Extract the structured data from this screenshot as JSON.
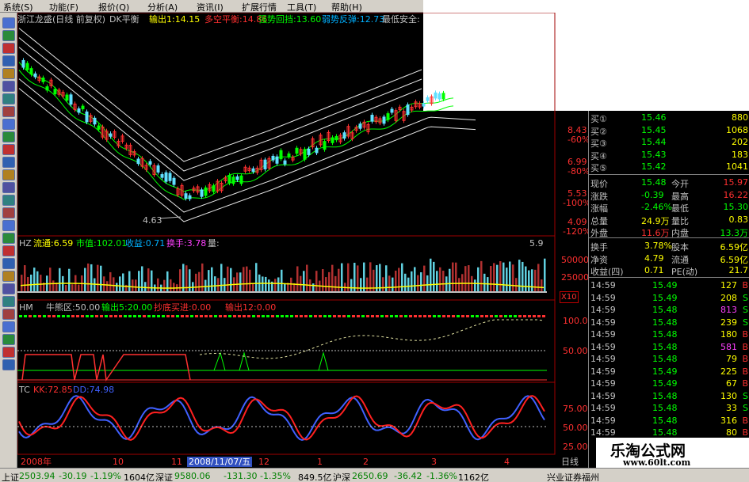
{
  "menu": [
    "系统(S)",
    "功能(F)",
    "报价(Q)",
    "分析(A)",
    "资讯(I)",
    "扩展行情",
    "工具(T)",
    "帮助(H)"
  ],
  "main_header": {
    "title": "浙江龙盛(日线 前复权)",
    "indicator": "DK平衡",
    "items": [
      {
        "text": "输出1:14.15",
        "color": "#ffff00"
      },
      {
        "text": "多空平衡:14.86",
        "color": "#ff3030"
      },
      {
        "text": "强势回挡:13.60",
        "color": "#00ff00"
      },
      {
        "text": "弱势反弹:12.73",
        "color": "#00b0ff"
      },
      {
        "text": "最低安全:",
        "color": "#c0c0c0"
      }
    ],
    "low_marker": "4.63"
  },
  "price_axis": [
    {
      "price": "8.43",
      "pct": "-60%"
    },
    {
      "price": "6.99",
      "pct": "-80%"
    },
    {
      "price": "5.53",
      "pct": "-100%"
    },
    {
      "price": "4.09",
      "pct": "-120%"
    }
  ],
  "hz_header": {
    "label": "HZ",
    "items": [
      {
        "text": "流通:6.59",
        "color": "#ffff00"
      },
      {
        "text": "市值:102.01",
        "color": "#00ff00"
      },
      {
        "text": "收益:0.71",
        "color": "#00b0ff"
      },
      {
        "text": "换手:3.78",
        "color": "#ff40ff"
      },
      {
        "text": "量:",
        "color": "#c0c0c0"
      }
    ],
    "right_value": "5.9"
  },
  "volume_axis": [
    "50000",
    "25000"
  ],
  "volume_unit": "X10",
  "hm_header": {
    "label": "HM",
    "items": [
      {
        "text": "牛熊区:50.00",
        "color": "#c0c0c0"
      },
      {
        "text": "输出5:20.00",
        "color": "#00ff00"
      },
      {
        "text": "抄底买进:0.00",
        "color": "#ff3030"
      },
      {
        "text": "输出12:0.00",
        "color": "#ff3030"
      }
    ]
  },
  "hm_axis": [
    "100.0",
    "50.00"
  ],
  "tc_header": {
    "label": "TC",
    "items": [
      {
        "text": "KK:72.85",
        "color": "#ff3030"
      },
      {
        "text": "DD:74.98",
        "color": "#4060ff"
      }
    ]
  },
  "tc_axis": [
    "75.00",
    "50.00",
    "25.00"
  ],
  "time_axis": {
    "labels": [
      "2008年",
      "10",
      "11",
      "12",
      "1",
      "2",
      "3",
      "4"
    ],
    "cursor_date": "2008/11/07/五",
    "period": "日线"
  },
  "quote": {
    "bids": [
      {
        "label": "买①",
        "price": "15.46",
        "vol": "880"
      },
      {
        "label": "买②",
        "price": "15.45",
        "vol": "1068"
      },
      {
        "label": "买③",
        "price": "15.44",
        "vol": "202"
      },
      {
        "label": "买④",
        "price": "15.43",
        "vol": "183"
      },
      {
        "label": "买⑤",
        "price": "15.42",
        "vol": "1041"
      }
    ],
    "stats": [
      {
        "l1": "现价",
        "v1": "15.48",
        "l2": "今开",
        "v2": "15.97",
        "c1": "#00ff00",
        "c2": "#ff3030"
      },
      {
        "l1": "涨跌",
        "v1": "-0.39",
        "l2": "最高",
        "v2": "16.22",
        "c1": "#00ff00",
        "c2": "#ff3030"
      },
      {
        "l1": "涨幅",
        "v1": "-2.46%",
        "l2": "最低",
        "v2": "15.30",
        "c1": "#00ff00",
        "c2": "#00ff00"
      },
      {
        "l1": "总量",
        "v1": "24.9万",
        "l2": "量比",
        "v2": "0.83",
        "c1": "#ffff00",
        "c2": "#ffff00"
      },
      {
        "l1": "外盘",
        "v1": "11.6万",
        "l2": "内盘",
        "v2": "13.3万",
        "c1": "#ff3030",
        "c2": "#00ff00"
      }
    ],
    "stats2": [
      {
        "l1": "换手",
        "v1": "3.78%",
        "l2": "股本",
        "v2": "6.59亿"
      },
      {
        "l1": "净资",
        "v1": "4.79",
        "l2": "流通",
        "v2": "6.59亿"
      },
      {
        "l1": "收益(四)",
        "v1": "0.71",
        "l2": "PE(动)",
        "v2": "21.7"
      }
    ],
    "ticks": [
      {
        "time": "14:59",
        "price": "15.49",
        "vol": "127",
        "bs": "B"
      },
      {
        "time": "14:59",
        "price": "15.49",
        "vol": "208",
        "bs": "S"
      },
      {
        "time": "14:59",
        "price": "15.48",
        "vol": "813",
        "bs": "S"
      },
      {
        "time": "14:59",
        "price": "15.48",
        "vol": "239",
        "bs": "S"
      },
      {
        "time": "14:59",
        "price": "15.48",
        "vol": "180",
        "bs": "B"
      },
      {
        "time": "14:59",
        "price": "15.48",
        "vol": "581",
        "bs": "B"
      },
      {
        "time": "14:59",
        "price": "15.48",
        "vol": "79",
        "bs": "B"
      },
      {
        "time": "14:59",
        "price": "15.49",
        "vol": "225",
        "bs": "B"
      },
      {
        "time": "14:59",
        "price": "15.49",
        "vol": "67",
        "bs": "B"
      },
      {
        "time": "14:59",
        "price": "15.48",
        "vol": "130",
        "bs": "S"
      },
      {
        "time": "14:59",
        "price": "15.48",
        "vol": "33",
        "bs": "S"
      },
      {
        "time": "14:59",
        "price": "15.48",
        "vol": "316",
        "bs": "B"
      },
      {
        "time": "14:59",
        "price": "15.48",
        "vol": "80",
        "bs": "B"
      }
    ]
  },
  "status_bar": [
    {
      "text": "上证",
      "color": "#000000"
    },
    {
      "text": "2503.94",
      "color": "#008000"
    },
    {
      "text": "-30.19",
      "color": "#008000"
    },
    {
      "text": "-1.19%",
      "color": "#008000"
    },
    {
      "text": "1604亿",
      "color": "#000000"
    },
    {
      "text": "深证",
      "color": "#000000"
    },
    {
      "text": "9580.06",
      "color": "#008000"
    },
    {
      "text": "-131.30",
      "color": "#008000"
    },
    {
      "text": "-1.35%",
      "color": "#008000"
    },
    {
      "text": "849.5亿",
      "color": "#000000"
    },
    {
      "text": "沪深",
      "color": "#000000"
    },
    {
      "text": "2650.69",
      "color": "#008000"
    },
    {
      "text": "-36.42",
      "color": "#008000"
    },
    {
      "text": "-1.36%",
      "color": "#008000"
    },
    {
      "text": "1162亿",
      "color": "#000000"
    },
    {
      "text": "兴业证券福州",
      "color": "#000000"
    }
  ],
  "watermark": {
    "title": "乐淘公式网",
    "url": "www.60lt.com"
  },
  "colors": {
    "up": "#ff3030",
    "down": "#00ff00",
    "axis": "#c00000",
    "accent": "#00ffff"
  }
}
